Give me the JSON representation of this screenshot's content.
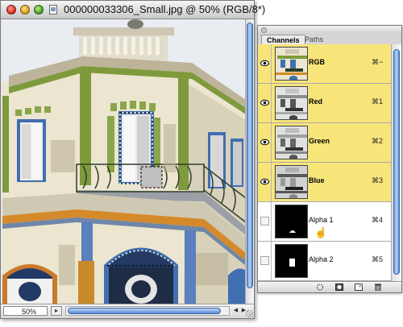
{
  "window": {
    "title": "000000033306_Small.jpg @ 50% (RGB/8*)",
    "zoom": "50%"
  },
  "palette": {
    "tabs": [
      {
        "label": "Channels",
        "active": true
      },
      {
        "label": "Paths",
        "active": false
      }
    ],
    "channels": [
      {
        "name": "RGB",
        "shortcut": "⌘~",
        "visible": true,
        "selected": true,
        "thumb": "color"
      },
      {
        "name": "Red",
        "shortcut": "⌘1",
        "visible": true,
        "selected": true,
        "thumb": "gray"
      },
      {
        "name": "Green",
        "shortcut": "⌘2",
        "visible": true,
        "selected": true,
        "thumb": "gray"
      },
      {
        "name": "Blue",
        "shortcut": "⌘3",
        "visible": true,
        "selected": true,
        "thumb": "gray"
      },
      {
        "name": "Alpha 1",
        "shortcut": "⌘4",
        "visible": false,
        "selected": false,
        "thumb": "alpha1"
      },
      {
        "name": "Alpha 2",
        "shortcut": "⌘5",
        "visible": false,
        "selected": false,
        "thumb": "alpha2"
      }
    ],
    "footer_buttons": [
      "load-selection-icon",
      "save-selection-icon",
      "new-channel-icon",
      "trash-icon"
    ]
  },
  "colors": {
    "selected_row": "#f7e57a",
    "facade_cream": "#ece5cf",
    "trim_green": "#7e9a3c",
    "accent_blue": "#3f6fb0",
    "scroll_blue": "#5b8ad1"
  }
}
